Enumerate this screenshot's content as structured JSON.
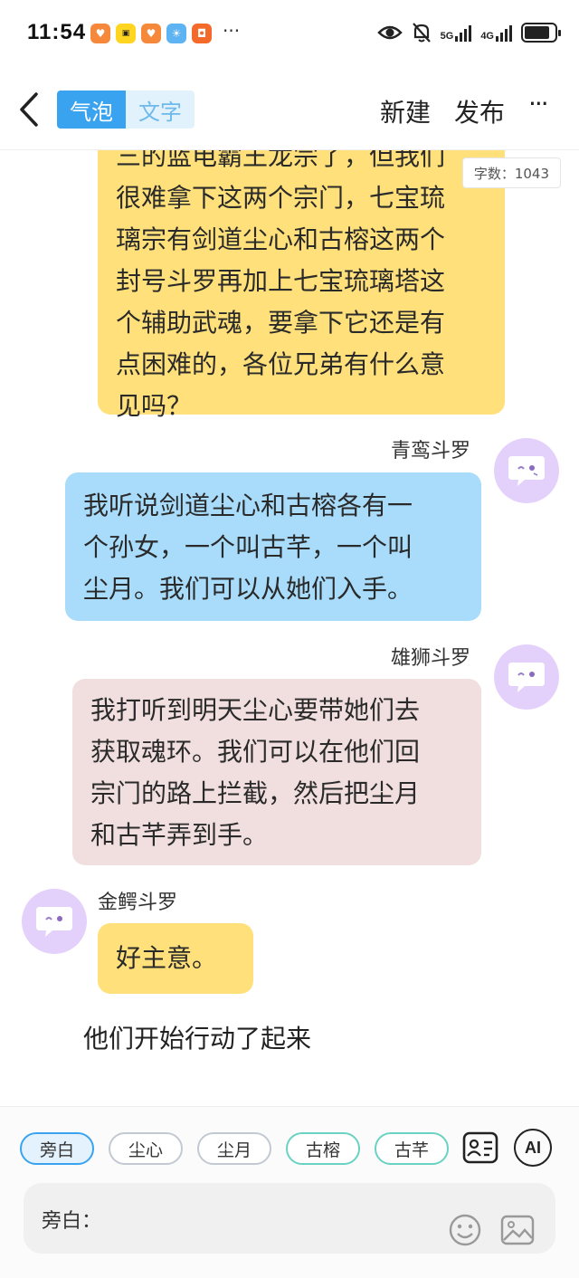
{
  "status_bar": {
    "time": "11:54",
    "more": "···",
    "net1": "5G",
    "net2": "4G",
    "battery_percent": 85
  },
  "header": {
    "tab_bubble": "气泡",
    "tab_text": "文字",
    "new_label": "新建",
    "publish_label": "发布",
    "more_label": "···"
  },
  "chat": {
    "word_count": "字数：1043",
    "messages": [
      {
        "text_lines": [
          "三的蓝电霸王龙宗了，但我们",
          "很难拿下这两个宗门，七宝琉",
          "璃宗有剑道尘心和古榕这两个",
          "封号斗罗再加上七宝琉璃塔这",
          "个辅助武魂，要拿下它还是有",
          "点困难的，各位兄弟有什么意",
          "见吗？"
        ]
      },
      {
        "speaker": "青鸾斗罗",
        "text_lines": [
          "我听说剑道尘心和古榕各有一",
          "个孙女，一个叫古芊，一个叫",
          "尘月。我们可以从她们入手。"
        ]
      },
      {
        "speaker": "雄狮斗罗",
        "text_lines": [
          "我打听到明天尘心要带她们去",
          "获取魂环。我们可以在他们回",
          "宗门的路上拦截，然后把尘月",
          "和古芊弄到手。"
        ]
      },
      {
        "speaker": "金鳄斗罗",
        "text_lines": [
          "好主意。"
        ]
      }
    ],
    "narration": "他们开始行动了起来"
  },
  "bottom": {
    "chips": [
      "旁白",
      "尘心",
      "尘月",
      "古榕",
      "古芊"
    ],
    "ai_label": "AI",
    "input_label": "旁白："
  },
  "colors": {
    "accent": "#3aa3f0",
    "bubble_yellow": "#ffe07a",
    "bubble_blue": "#a8dcfa",
    "bubble_pink": "#f1dfdf",
    "avatar": "#e4d1fb"
  }
}
